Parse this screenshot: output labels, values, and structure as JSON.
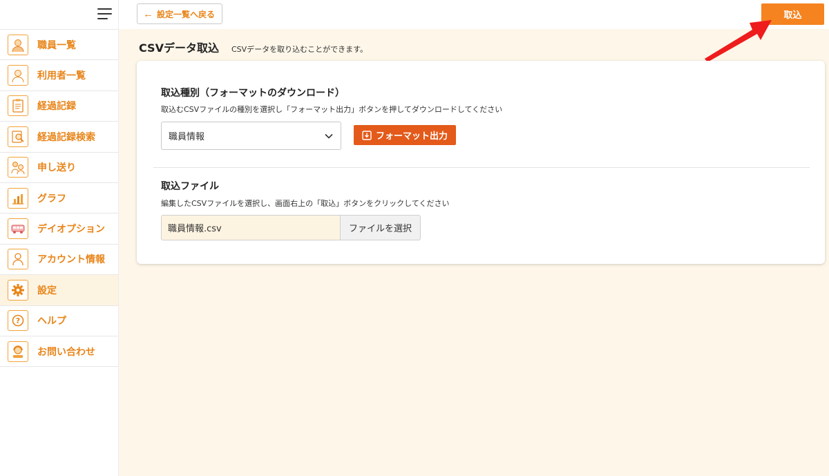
{
  "sidebar": {
    "items": [
      {
        "label": "職員一覧",
        "icon": "staff-icon"
      },
      {
        "label": "利用者一覧",
        "icon": "user-icon"
      },
      {
        "label": "経過記録",
        "icon": "clipboard-icon"
      },
      {
        "label": "経過記録検索",
        "icon": "search-record-icon"
      },
      {
        "label": "申し送り",
        "icon": "handover-icon"
      },
      {
        "label": "グラフ",
        "icon": "graph-icon"
      },
      {
        "label": "デイオプション",
        "icon": "car-icon"
      },
      {
        "label": "アカウント情報",
        "icon": "account-icon"
      },
      {
        "label": "設定",
        "icon": "gear-icon"
      },
      {
        "label": "ヘルプ",
        "icon": "help-icon"
      },
      {
        "label": "お問い合わせ",
        "icon": "contact-icon"
      }
    ],
    "active_index": 8
  },
  "topbar": {
    "back_label": "設定一覧へ戻る",
    "import_label": "取込"
  },
  "page": {
    "title": "CSVデータ取込",
    "description": "CSVデータを取り込むことができます。"
  },
  "format_section": {
    "title": "取込種別（フォーマットのダウンロード）",
    "description": "取込むCSVファイルの種別を選択し「フォーマット出力」ボタンを押してダウンロードしてください",
    "selected_type": "職員情報",
    "format_button_label": "フォーマット出力"
  },
  "file_section": {
    "title": "取込ファイル",
    "description": "編集したCSVファイルを選択し、画面右上の「取込」ボタンをクリックしてください",
    "file_name": "職員情報.csv",
    "select_button_label": "ファイルを選択"
  },
  "colors": {
    "accent": "#f5831f",
    "format_button": "#e35a1a",
    "background": "#fdf6e9",
    "annotation_arrow": "#ee1c1c"
  }
}
